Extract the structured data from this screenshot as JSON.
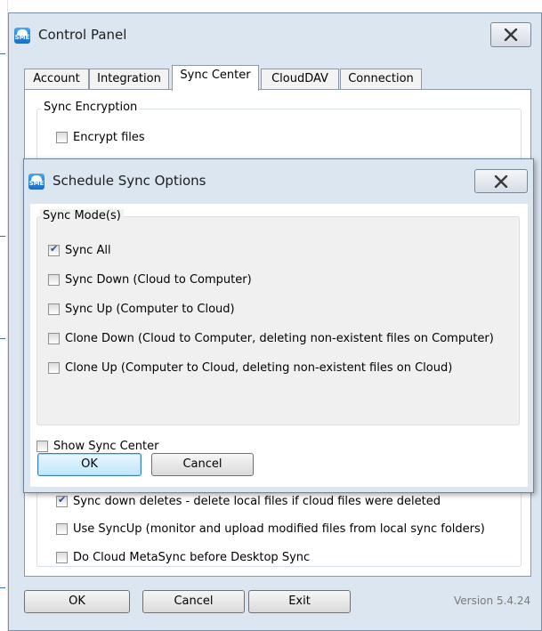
{
  "window": {
    "title": "Control Panel",
    "icon": "sme-cloud-icon"
  },
  "tabs": [
    {
      "label": "Account",
      "active": false
    },
    {
      "label": "Integration",
      "active": false
    },
    {
      "label": "Sync Center",
      "active": true
    },
    {
      "label": "CloudDAV",
      "active": false
    },
    {
      "label": "Connection",
      "active": false
    }
  ],
  "sync_center": {
    "encryption_group_label": "Sync Encryption",
    "encrypt_files": {
      "label": "Encrypt files",
      "checked": false
    },
    "options": [
      {
        "label": "Sync down deletes - delete local files if cloud files were deleted",
        "checked": true
      },
      {
        "label": "Use SyncUp (monitor and upload modified files from local sync folders)",
        "checked": false
      },
      {
        "label": "Do Cloud MetaSync before Desktop Sync",
        "checked": false
      }
    ]
  },
  "footer": {
    "ok_label": "OK",
    "cancel_label": "Cancel",
    "exit_label": "Exit",
    "version": "Version 5.4.24"
  },
  "dialog": {
    "title": "Schedule Sync Options",
    "group_label": "Sync Mode(s)",
    "modes": [
      {
        "label": "Sync All",
        "checked": true
      },
      {
        "label": "Sync Down (Cloud to Computer)",
        "checked": false
      },
      {
        "label": "Sync Up (Computer to Cloud)",
        "checked": false
      },
      {
        "label": "Clone Down (Cloud to Computer, deleting non-existent files on Computer)",
        "checked": false
      },
      {
        "label": "Clone Up (Computer to Cloud, deleting non-existent files on Cloud)",
        "checked": false
      }
    ],
    "show_sync_center": {
      "label": "Show Sync Center",
      "checked": false
    },
    "ok_label": "OK",
    "cancel_label": "Cancel"
  },
  "colors": {
    "frame": "#dce6f1",
    "default_button": "#bee6fd",
    "check_mark": "#2a4e9b"
  }
}
